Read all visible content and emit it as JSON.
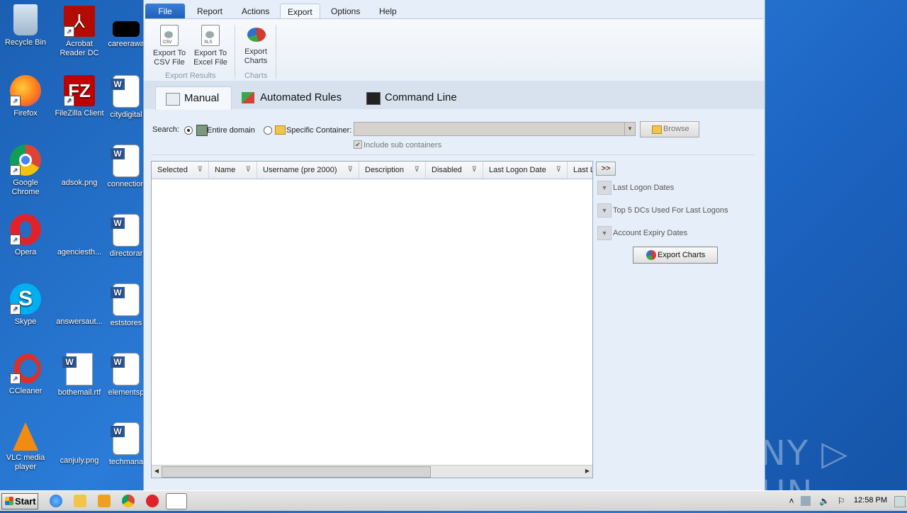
{
  "desktop": {
    "icons": [
      {
        "label": "Recycle Bin"
      },
      {
        "label": "Acrobat Reader DC"
      },
      {
        "label": "careerawa"
      },
      {
        "label": "Firefox"
      },
      {
        "label": "FileZilla Client"
      },
      {
        "label": "citydigital"
      },
      {
        "label": "Google Chrome"
      },
      {
        "label": "adsok.png"
      },
      {
        "label": "connection"
      },
      {
        "label": "Opera"
      },
      {
        "label": "agenciesth..."
      },
      {
        "label": "directorar"
      },
      {
        "label": "Skype"
      },
      {
        "label": "answersaut..."
      },
      {
        "label": "eststores"
      },
      {
        "label": "CCleaner"
      },
      {
        "label": "bothemail.rtf"
      },
      {
        "label": "elementsp"
      },
      {
        "label": "VLC media player"
      },
      {
        "label": "canjuly.png"
      },
      {
        "label": "techmana"
      }
    ],
    "watermark": "ANY ▷ RUN"
  },
  "app": {
    "menu": {
      "file": "File",
      "report": "Report",
      "actions": "Actions",
      "export": "Export",
      "options": "Options",
      "help": "Help"
    },
    "ribbon": {
      "csv": "Export To CSV File",
      "excel": "Export To Excel File",
      "charts": "Export Charts",
      "group_results": "Export Results",
      "group_charts": "Charts",
      "csv_badge": "CSV",
      "xls_badge": "XLS"
    },
    "tabs": {
      "manual": "Manual",
      "automated": "Automated Rules",
      "command": "Command Line"
    },
    "search": {
      "label": "Search:",
      "entire_domain": "Entire domain",
      "specific_container": "Specific Container:",
      "container_value": "",
      "browse": "Browse",
      "include_sub": "Include sub containers"
    },
    "grid": {
      "columns": [
        "Selected",
        "Name",
        "Username (pre 2000)",
        "Description",
        "Disabled",
        "Last Logon Date",
        "Last L"
      ]
    },
    "charts_panel": {
      "expand": ">>",
      "options": [
        "Last Logon Dates",
        "Top 5 DCs Used For Last Logons",
        "Account Expiry Dates"
      ],
      "export_button": "Export Charts"
    }
  },
  "taskbar": {
    "start": "Start",
    "clock": "12:58 PM"
  }
}
